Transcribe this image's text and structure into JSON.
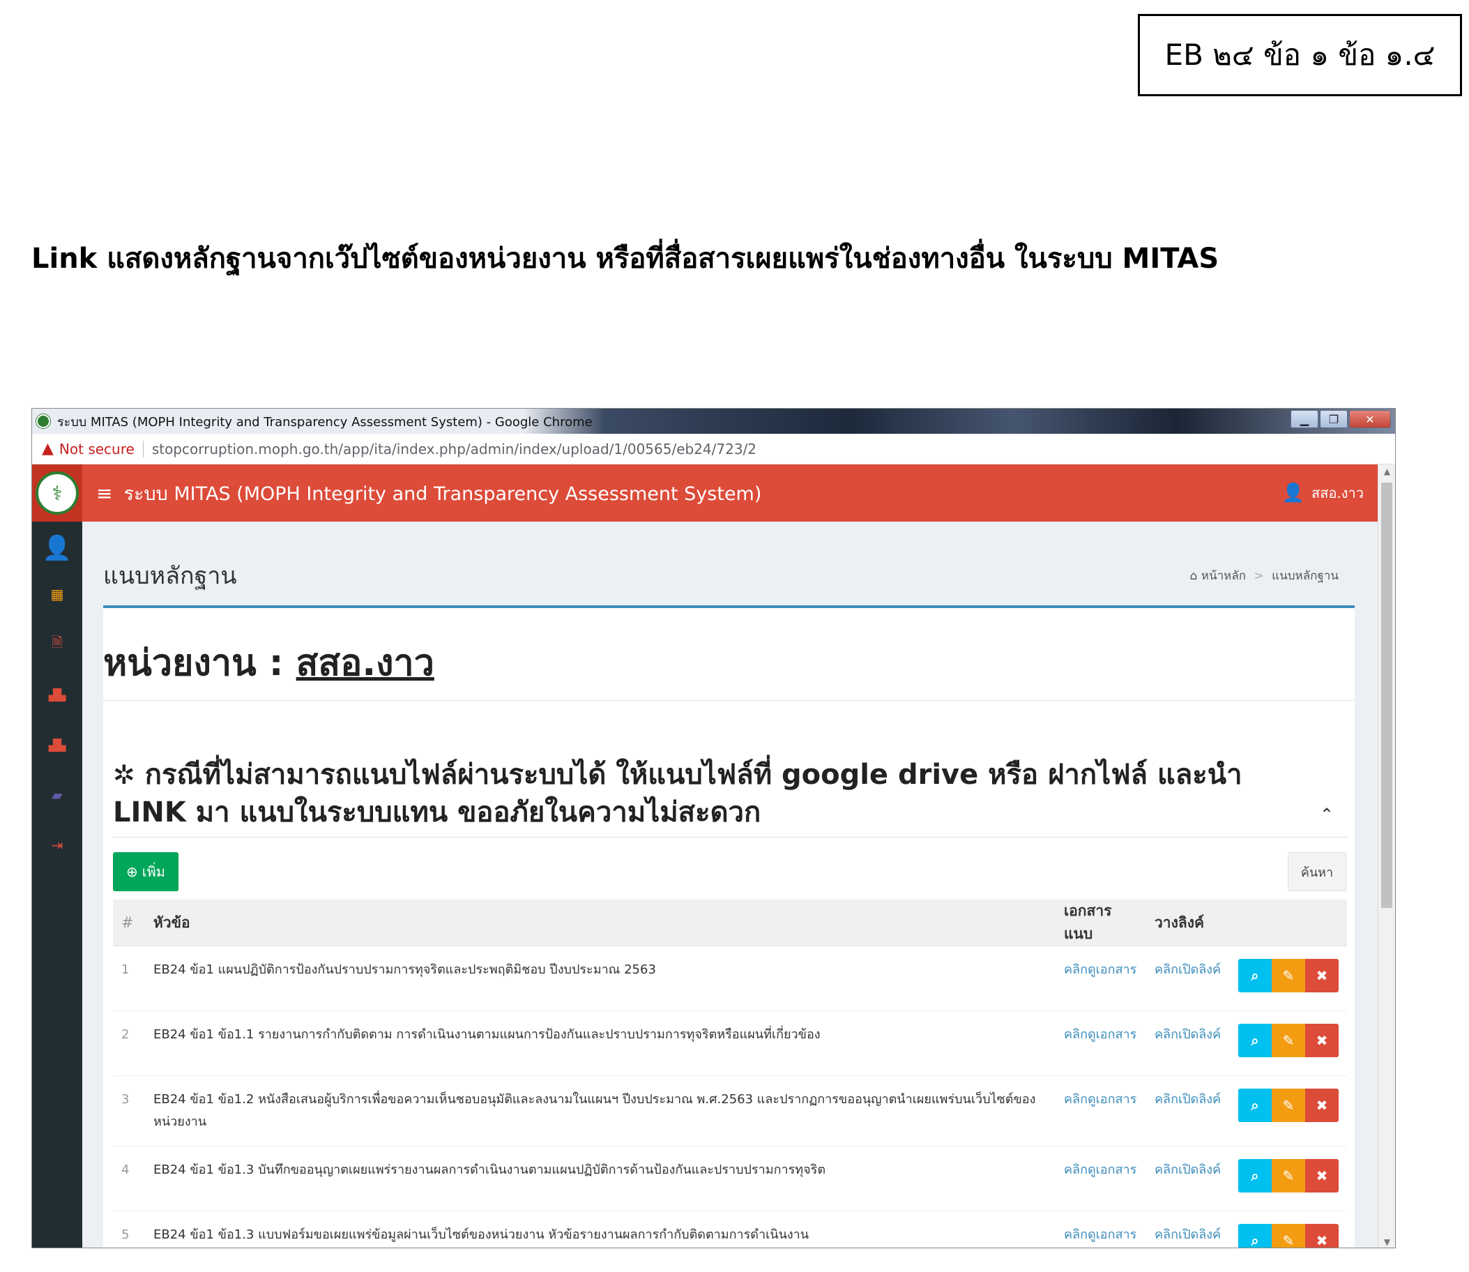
{
  "doc": {
    "eb_label": "EB ๒๔ ข้อ ๑ ข้อ ๑.๔",
    "heading": "Link แสดงหลักฐานจากเว๊ปไซต์ของหน่วยงาน หรือที่สื่อสารเผยแพร่ในช่องทางอื่น ในระบบ MITAS"
  },
  "window": {
    "title": "ระบบ MITAS (MOPH Integrity and Transparency Assessment System) - Google Chrome",
    "minimize": "▁",
    "restore": "❐",
    "close": "✕"
  },
  "address": {
    "warning": "Not secure",
    "url": "stopcorruption.moph.go.th/app/ita/index.php/admin/index/upload/1/00565/eb24/723/2"
  },
  "app": {
    "title": "ระบบ MITAS (MOPH Integrity and Transparency Assessment System)",
    "user": "สสอ.งาว"
  },
  "sidebar": {
    "icons": [
      {
        "name": "user-icon",
        "glyph": "👤",
        "color": "#ffffff"
      },
      {
        "name": "calendar-icon",
        "glyph": "▦",
        "color": "#f39c12"
      },
      {
        "name": "document-icon",
        "glyph": "🗎",
        "color": "#dd4b39"
      },
      {
        "name": "bar-chart-icon",
        "glyph": "📊",
        "color": "#dd4b39"
      },
      {
        "name": "bar-chart-icon-2",
        "glyph": "📊",
        "color": "#dd4b39"
      },
      {
        "name": "book-icon",
        "glyph": "📘",
        "color": "#605ca8"
      },
      {
        "name": "sign-out-icon",
        "glyph": "⇥",
        "color": "#dd4b39"
      }
    ]
  },
  "page": {
    "title": "แนบหลักฐาน",
    "breadcrumb_home": "หน้าหลัก",
    "breadcrumb_current": "แนบหลักฐาน",
    "unit_label": "หน่วยงาน :",
    "unit_name": "สสอ.งาว",
    "notice": "กรณีที่ไม่สามารถแนบไฟล์ผ่านระบบได้ ให้แนบไฟล์ที่ google drive หรือ ฝากไฟล์ และนำ LINK มา แนบในระบบแทน ขออภัยในความไม่สะดวก",
    "add_label": "เพิ่ม",
    "search_label": "ค้นหา"
  },
  "table": {
    "headers": {
      "num": "#",
      "topic": "หัวข้อ",
      "doc": "เอกสารแนบ",
      "link": "วางลิงค์"
    },
    "rows": [
      {
        "num": "1",
        "topic": "EB24 ข้อ1 แผนปฏิบัติการป้องกันปราบปรามการทุจริตและประพฤติมิชอบ ปีงบประมาณ 2563",
        "doc": "คลิกดูเอกสาร",
        "link": "คลิกเปิดลิงค์"
      },
      {
        "num": "2",
        "topic": "EB24 ข้อ1 ข้อ1.1 รายงานการกำกับติดตาม การดำเนินงานตามแผนการป้องกันและปราบปรามการทุจริตหรือแผนที่เกี่ยวข้อง",
        "doc": "คลิกดูเอกสาร",
        "link": "คลิกเปิดลิงค์"
      },
      {
        "num": "3",
        "topic": "EB24 ข้อ1 ข้อ1.2 หนังสือเสนอผู้บริการเพื่อขอความเห็นชอบอนุมัติและลงนามในแผนฯ ปีงบประมาณ พ.ศ.2563 และปรากฏการขออนุญาตนำเผยแพร่บนเว็บไซต์ของหน่วยงาน",
        "doc": "คลิกดูเอกสาร",
        "link": "คลิกเปิดลิงค์"
      },
      {
        "num": "4",
        "topic": "EB24 ข้อ1 ข้อ1.3 บันทึกขออนุญาตเผยแพร่รายงานผลการดำเนินงานตามแผนปฏิบัติการด้านป้องกันและปราบปรามการทุจริต",
        "doc": "คลิกดูเอกสาร",
        "link": "คลิกเปิดลิงค์"
      },
      {
        "num": "5",
        "topic": "EB24 ข้อ1 ข้อ1.3 แบบฟอร์มขอเผยแพร่ข้อมูลผ่านเว็บไซต์ของหน่วยงาน หัวข้อรายงานผลการกำกับติดตามการดำเนินงาน",
        "doc": "คลิกดูเอกสาร",
        "link": "คลิกเปิดลิงค์"
      }
    ]
  }
}
